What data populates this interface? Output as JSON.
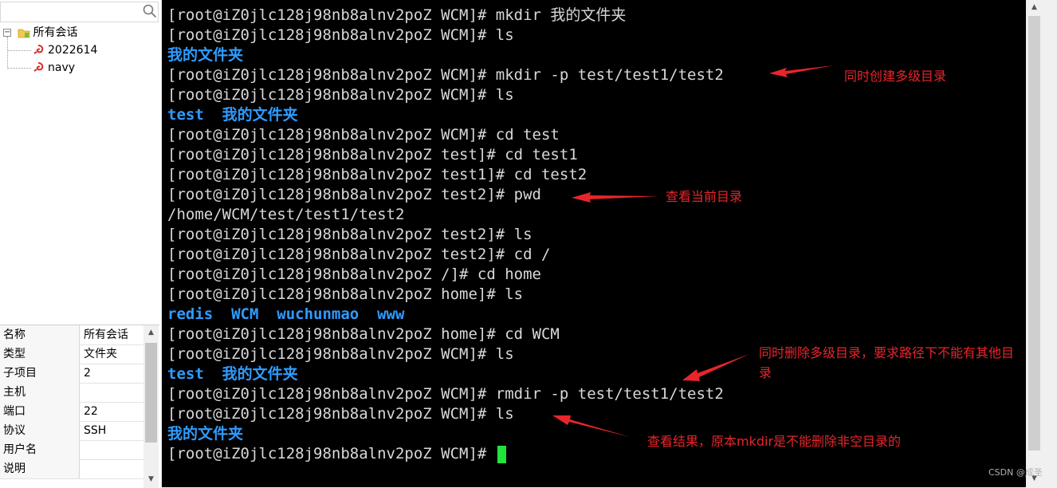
{
  "sidebar": {
    "search_placeholder": "",
    "tree": {
      "root_label": "所有会话",
      "sessions": [
        "2022614",
        "navy"
      ]
    },
    "properties": [
      {
        "key": "名称",
        "value": "所有会话"
      },
      {
        "key": "类型",
        "value": "文件夹"
      },
      {
        "key": "子项目",
        "value": "2"
      },
      {
        "key": "主机",
        "value": ""
      },
      {
        "key": "端口",
        "value": "22"
      },
      {
        "key": "协议",
        "value": "SSH"
      },
      {
        "key": "用户名",
        "value": ""
      },
      {
        "key": "说明",
        "value": ""
      }
    ]
  },
  "terminal": {
    "lines": [
      {
        "text": "[root@iZ0jlc128j98nb8alnv2poZ WCM]# mkdir 我的文件夹",
        "type": "cmd"
      },
      {
        "text": "[root@iZ0jlc128j98nb8alnv2poZ WCM]# ls",
        "type": "cmd"
      },
      {
        "text": "我的文件夹",
        "type": "dir"
      },
      {
        "text": "[root@iZ0jlc128j98nb8alnv2poZ WCM]# mkdir -p test/test1/test2",
        "type": "cmd"
      },
      {
        "text": "[root@iZ0jlc128j98nb8alnv2poZ WCM]# ls",
        "type": "cmd"
      },
      {
        "text": "test  我的文件夹",
        "type": "dir"
      },
      {
        "text": "[root@iZ0jlc128j98nb8alnv2poZ WCM]# cd test",
        "type": "cmd"
      },
      {
        "text": "[root@iZ0jlc128j98nb8alnv2poZ test]# cd test1",
        "type": "cmd"
      },
      {
        "text": "[root@iZ0jlc128j98nb8alnv2poZ test1]# cd test2",
        "type": "cmd"
      },
      {
        "text": "[root@iZ0jlc128j98nb8alnv2poZ test2]# pwd",
        "type": "cmd"
      },
      {
        "text": "/home/WCM/test/test1/test2",
        "type": "out"
      },
      {
        "text": "[root@iZ0jlc128j98nb8alnv2poZ test2]# ls",
        "type": "cmd"
      },
      {
        "text": "[root@iZ0jlc128j98nb8alnv2poZ test2]# cd /",
        "type": "cmd"
      },
      {
        "text": "[root@iZ0jlc128j98nb8alnv2poZ /]# cd home",
        "type": "cmd"
      },
      {
        "text": "[root@iZ0jlc128j98nb8alnv2poZ home]# ls",
        "type": "cmd"
      },
      {
        "text": "redis  WCM  wuchunmao  www",
        "type": "dir"
      },
      {
        "text": "[root@iZ0jlc128j98nb8alnv2poZ home]# cd WCM",
        "type": "cmd"
      },
      {
        "text": "[root@iZ0jlc128j98nb8alnv2poZ WCM]# ls",
        "type": "cmd"
      },
      {
        "text": "test  我的文件夹",
        "type": "dir"
      },
      {
        "text": "[root@iZ0jlc128j98nb8alnv2poZ WCM]# rmdir -p test/test1/test2",
        "type": "cmd"
      },
      {
        "text": "[root@iZ0jlc128j98nb8alnv2poZ WCM]# ls",
        "type": "cmd"
      },
      {
        "text": "我的文件夹",
        "type": "dir"
      },
      {
        "text": "[root@iZ0jlc128j98nb8alnv2poZ WCM]# ",
        "type": "prompt"
      }
    ]
  },
  "annotations": {
    "mkdir_p": "同时创建多级目录",
    "pwd": "查看当前目录",
    "rmdir_p_line1": "同时删除多级目录，要求路径下不能有其他目",
    "rmdir_p_line2": "录",
    "result": "查看结果，原本mkdir是不能删除非空目录的"
  },
  "watermark": "CSDN @成圣",
  "colors": {
    "terminal_bg": "#000000",
    "terminal_text": "#d8d8d8",
    "directory_text": "#2f9cff",
    "cursor": "#22e33a",
    "annotation": "#e8252b"
  }
}
